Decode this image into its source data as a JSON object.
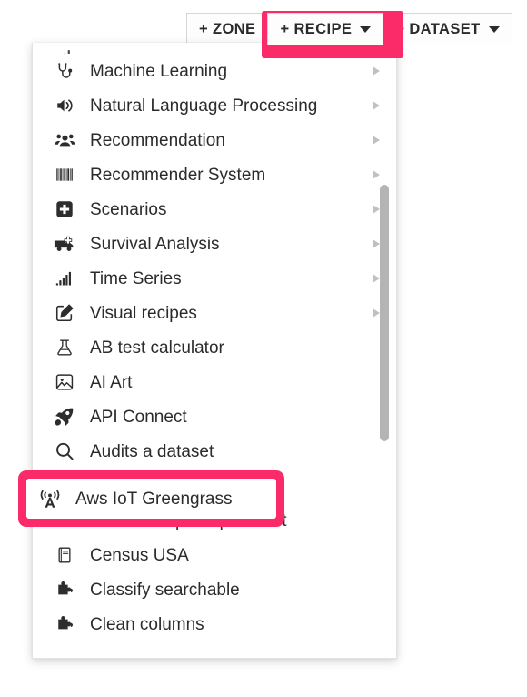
{
  "toolbar": {
    "zone_label": "+ ZONE",
    "recipe_label": "+ RECIPE",
    "dataset_label": "+ DATASET",
    "highlight_color": "#fb2a68"
  },
  "menu": {
    "clipped_top_item": {
      "label": "",
      "icon": "clipped-icon"
    },
    "items": [
      {
        "label": "Machine Learning",
        "icon": "stethoscope-icon",
        "submenu": true
      },
      {
        "label": "Natural Language Processing",
        "icon": "speaker-icon",
        "submenu": true
      },
      {
        "label": "Recommendation",
        "icon": "users-icon",
        "submenu": true
      },
      {
        "label": "Recommender System",
        "icon": "barcode-icon",
        "submenu": true
      },
      {
        "label": "Scenarios",
        "icon": "first-aid-kit-icon",
        "submenu": true
      },
      {
        "label": "Survival Analysis",
        "icon": "ambulance-icon",
        "submenu": true
      },
      {
        "label": "Time Series",
        "icon": "signal-bars-icon",
        "submenu": true
      },
      {
        "label": "Visual recipes",
        "icon": "pencil-square-icon",
        "submenu": true
      },
      {
        "label": "AB test calculator",
        "icon": "flask-icon",
        "submenu": false
      },
      {
        "label": "AI Art",
        "icon": "image-icon",
        "submenu": false
      },
      {
        "label": "API Connect",
        "icon": "rocket-icon",
        "submenu": false
      },
      {
        "label": "Audits a dataset",
        "icon": "magnifier-icon",
        "submenu": false
      },
      {
        "label": "Aws IoT Greengrass",
        "icon": "broadcast-tower-icon",
        "submenu": false
      },
      {
        "label": "Cads snowpark quick test",
        "icon": "puzzle-piece-icon",
        "submenu": false
      },
      {
        "label": "Census USA",
        "icon": "book-icon",
        "submenu": false
      },
      {
        "label": "Classify searchable",
        "icon": "puzzle-piece-icon",
        "submenu": false
      },
      {
        "label": "Clean columns",
        "icon": "puzzle-piece-icon",
        "submenu": false
      }
    ],
    "highlighted_item": "Aws IoT Greengrass",
    "highlight_color": "#fb2a68"
  },
  "scrollbar": {
    "thumb_color": "#b4b4b4"
  }
}
